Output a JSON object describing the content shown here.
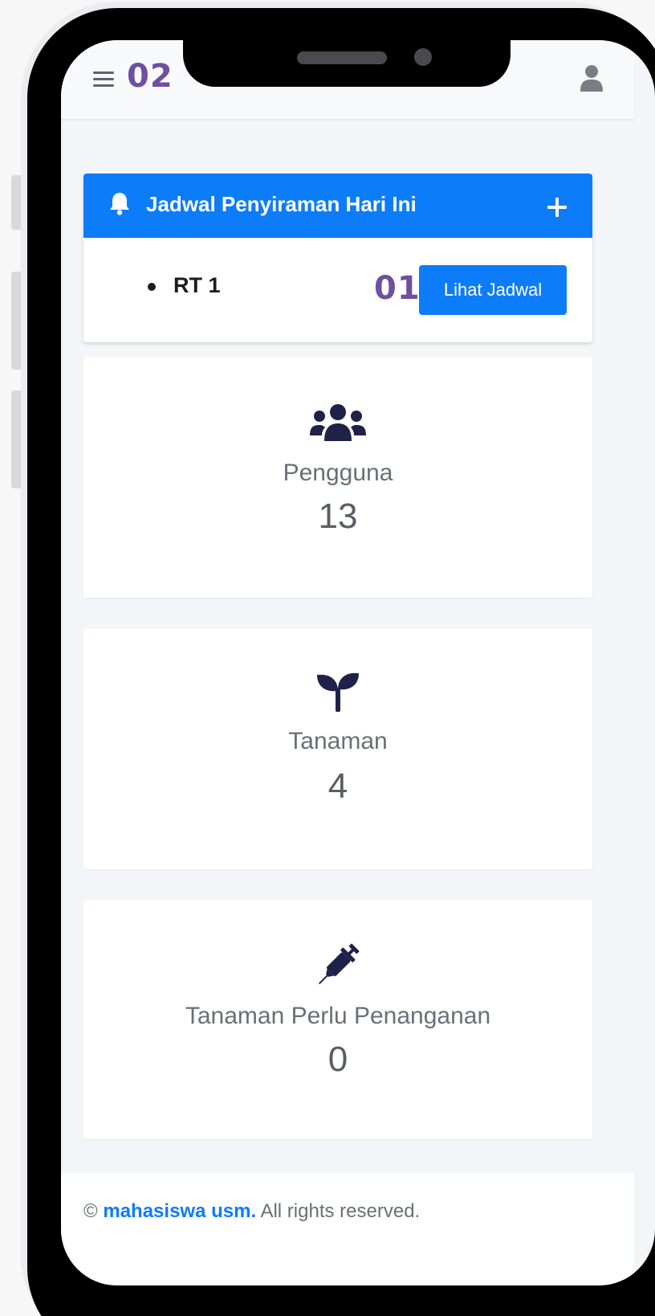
{
  "annotations": {
    "marker_top": "02",
    "marker_button": "01"
  },
  "header": {
    "menu_icon": "hamburger-icon",
    "user_icon": "user-icon"
  },
  "schedule": {
    "title": "Jadwal Penyiraman Hari Ini",
    "icon": "bell-icon",
    "add_icon": "plus-icon",
    "item": "RT 1",
    "button_label": "Lihat Jadwal",
    "accent_color": "#0d7cf9"
  },
  "stats": [
    {
      "icon": "users-icon",
      "label": "Pengguna",
      "value": "13"
    },
    {
      "icon": "seedling-icon",
      "label": "Tanaman",
      "value": "4"
    },
    {
      "icon": "syringe-icon",
      "label": "Tanaman Perlu Penanganan",
      "value": "0"
    }
  ],
  "footer": {
    "copyright": "©",
    "link": "mahasiswa usm.",
    "rights": " All rights reserved."
  }
}
